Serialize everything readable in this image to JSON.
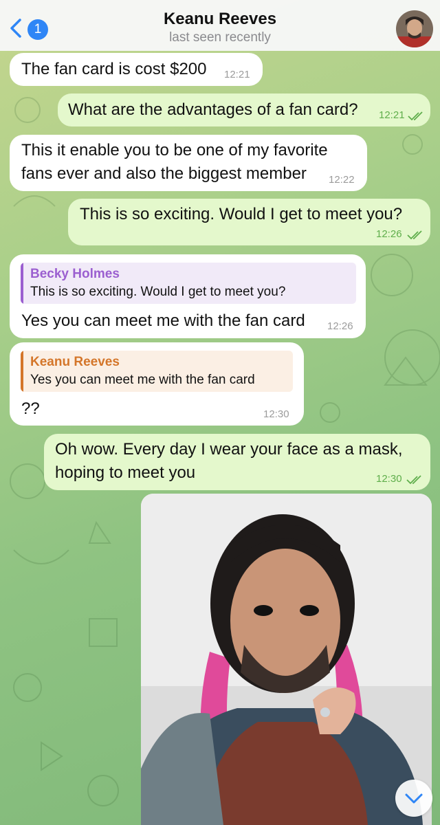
{
  "header": {
    "back_count": "1",
    "title": "Keanu Reeves",
    "status": "last seen recently"
  },
  "messages": [
    {
      "text": "The fan card is cost $200",
      "time": "12:21"
    },
    {
      "text": "What are the advantages of a fan card?",
      "time": "12:21"
    },
    {
      "line1": "This it  enable you to be one of my favorite",
      "line2": "fans ever and also the biggest member",
      "time": "12:22"
    },
    {
      "text": "This is so exciting. Would I get to meet you?",
      "time": "12:26"
    },
    {
      "reply_name": "Becky Holmes",
      "reply_text": "This is so exciting. Would I get to meet you?",
      "text": "Yes you can meet me with the fan card",
      "time": "12:26"
    },
    {
      "reply_name": "Keanu Reeves",
      "reply_text": "Yes you can meet me with the fan card",
      "text": "??",
      "time": "12:30"
    },
    {
      "line1": "Oh wow. Every day I wear your face as a mask,",
      "line2": "hoping to meet you",
      "time": "12:30"
    }
  ],
  "colors": {
    "accent": "#2f86f6",
    "reply_purple": "#9b5fd0",
    "reply_orange": "#d4762a",
    "outgoing_bubble": "#e4f8cc",
    "check_green": "#5fae4b"
  },
  "icons": {
    "back": "chevron-left-icon",
    "read": "double-check-icon",
    "scroll": "chevron-down-icon"
  }
}
